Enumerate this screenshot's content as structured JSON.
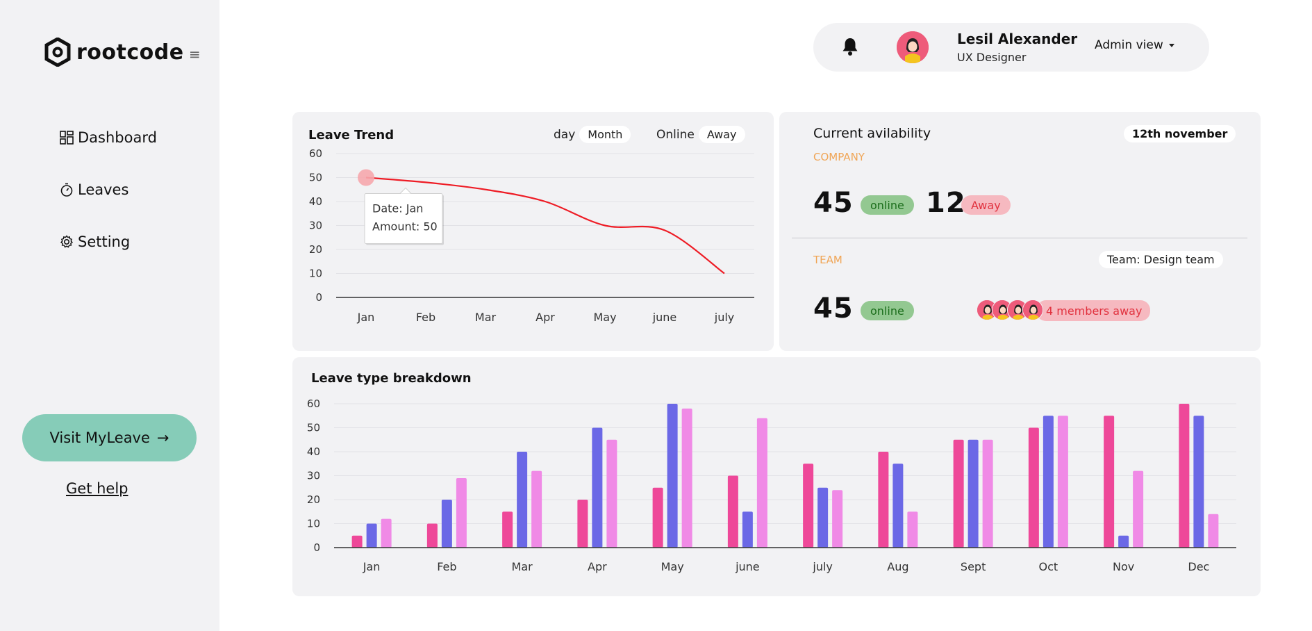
{
  "app": {
    "logo_text": "rootcode",
    "nav": [
      {
        "label": "Dashboard",
        "icon": "grid-icon"
      },
      {
        "label": "Leaves",
        "icon": "stopwatch-icon"
      },
      {
        "label": "Setting",
        "icon": "gear-icon"
      }
    ],
    "visit_button": "Visit MyLeave",
    "visit_arrow": "→",
    "help_link": "Get help"
  },
  "profile": {
    "name": "Lesil Alexander",
    "role": "UX Designer",
    "view_label": "Admin view"
  },
  "trend": {
    "title": "Leave Trend",
    "toggle_a": {
      "plain": "day",
      "pill": "Month"
    },
    "toggle_b": {
      "plain": "Online",
      "pill": "Away"
    },
    "tooltip_line1": "Date: Jan",
    "tooltip_line2": "Amount: 50"
  },
  "availability": {
    "title": "Current avilability",
    "date": "12th november",
    "company_label": "COMPANY",
    "company_online": "45",
    "online_label": "online",
    "company_away": "12",
    "away_label": "Away",
    "team_label": "TEAM",
    "team_select": "Team: Design team",
    "team_online": "45",
    "team_online_label": "online",
    "members_away": "4 members away"
  },
  "breakdown": {
    "title": "Leave type breakdown"
  },
  "colors": {
    "line": "#ee1c25",
    "series1": "#ee4899",
    "series2": "#6b68e6",
    "series3": "#f08ae6",
    "accent_button": "#86ccb8"
  },
  "chart_data": [
    {
      "type": "line",
      "title": "Leave Trend",
      "categories": [
        "Jan",
        "Feb",
        "Mar",
        "Apr",
        "May",
        "june",
        "july"
      ],
      "values": [
        50,
        48,
        45,
        40,
        30,
        28,
        10
      ],
      "ylim": [
        0,
        60
      ],
      "yticks": [
        0,
        10,
        20,
        30,
        40,
        50,
        60
      ],
      "grid": true
    },
    {
      "type": "bar",
      "title": "Leave type breakdown",
      "categories": [
        "Jan",
        "Feb",
        "Mar",
        "Apr",
        "May",
        "june",
        "july",
        "Aug",
        "Sept",
        "Oct",
        "Nov",
        "Dec"
      ],
      "series": [
        {
          "values": [
            5,
            10,
            15,
            20,
            25,
            30,
            35,
            40,
            45,
            50,
            55,
            60
          ]
        },
        {
          "values": [
            10,
            20,
            40,
            50,
            60,
            15,
            25,
            35,
            45,
            55,
            5,
            55
          ]
        },
        {
          "values": [
            12,
            29,
            32,
            45,
            58,
            54,
            24,
            15,
            45,
            55,
            32,
            14
          ]
        }
      ],
      "ylim": [
        0,
        60
      ],
      "yticks": [
        0,
        10,
        20,
        30,
        40,
        50,
        60
      ],
      "grid": true
    }
  ]
}
